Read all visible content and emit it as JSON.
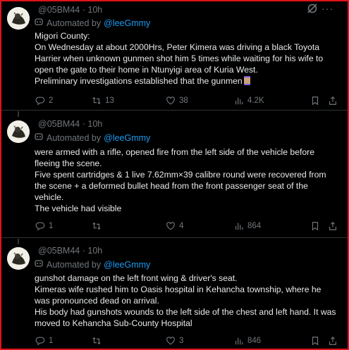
{
  "tweets": [
    {
      "handle": "@05BM44",
      "sep": "·",
      "time": "10h",
      "automated_prefix": "Automated by",
      "automated_link": "@leeGmmy",
      "lines": [
        "Migori County:",
        "On Wednesday at about 2000Hrs, Peter Kimera was driving a black Toyota Harrier when unknown gunmen shot him 5 times while waiting for his wife to open the gate to their home in Ntunyigi area of Kuria West.",
        "Preliminary investigations established that the gunmen"
      ],
      "replies": "2",
      "retweets": "13",
      "likes": "38",
      "views": "4.2K"
    },
    {
      "handle": "@05BM44",
      "sep": "·",
      "time": "10h",
      "automated_prefix": "Automated by",
      "automated_link": "@leeGmmy",
      "lines": [
        "were armed with a rifle, opened fire from the left side of the vehicle before fleeing the scene.",
        "Five spent cartridges & 1 live 7.62mm×39 calibre round were recovered from the scene + a deformed bullet head from the front passenger seat of the vehicle.",
        "The vehicle had visible"
      ],
      "replies": "1",
      "retweets": "",
      "likes": "4",
      "views": "864"
    },
    {
      "handle": "@05BM44",
      "sep": "·",
      "time": "10h",
      "automated_prefix": "Automated by",
      "automated_link": "@leeGmmy",
      "lines": [
        "gunshot damage on the left front wing & driver's seat.",
        "Kimeras wife rushed him to Oasis hospital in Kehancha township, where he was pronounced dead on arrival.",
        "His body had gunshots wounds to the left side of the chest and left hand. It was moved to Kehancha Sub-County Hospital"
      ],
      "replies": "1",
      "retweets": "",
      "likes": "3",
      "views": "846"
    }
  ],
  "icons": {
    "grok": "grok-icon",
    "more": "more-icon",
    "automated": "robot-icon",
    "reply": "reply-icon",
    "retweet": "retweet-icon",
    "like": "heart-icon",
    "views": "views-icon",
    "bookmark": "bookmark-icon",
    "share": "share-icon",
    "thread": "thread-icon"
  },
  "colors": {
    "background": "#000000",
    "text": "#e7e9ea",
    "muted": "#71767b",
    "link": "#1d9bf0",
    "border": "#e0131a"
  }
}
